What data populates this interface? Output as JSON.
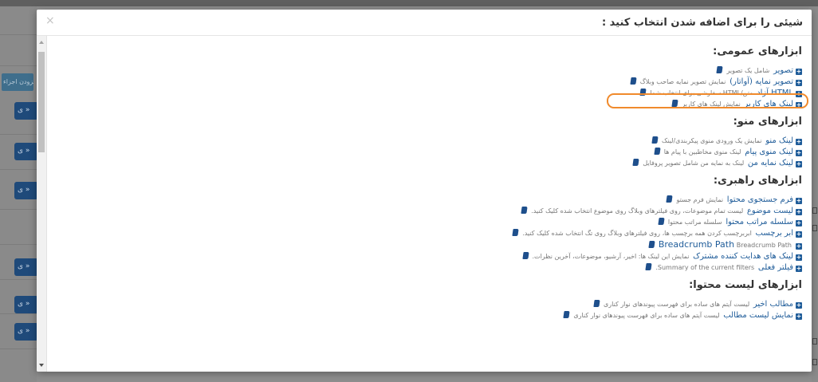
{
  "modal": {
    "title": "شیئی را برای اضافه شدن انتخاب کنید :",
    "close": "×",
    "sections": [
      {
        "title": "ابزارهای عمومی:",
        "items": [
          {
            "name": "تصویر",
            "desc": "شامل یک تصویر"
          },
          {
            "name": "تصویر نمایه (آواتار)",
            "desc": "نمایش تصویر نمایه صاحب وبلاگ"
          },
          {
            "name": "HTML آزاد",
            "desc": "متن/HTML سفارشی برای انتخاب شما"
          },
          {
            "name": "لینک های کاربر",
            "desc": "نمایش لینک های کاربر"
          }
        ]
      },
      {
        "title": "ابزارهای منو:",
        "items": [
          {
            "name": "لینک منو",
            "desc": "نمایش یک ورودی منوی پیکربندی/لینک"
          },
          {
            "name": "لینک منوی پیام",
            "desc": "لینک منوی مخاطبین با پیام ها"
          },
          {
            "name": "لینک نمایه من",
            "desc": "لینک به نمایه من شامل تصویر پروفایل"
          }
        ]
      },
      {
        "title": "ابزارهای راهبری:",
        "items": [
          {
            "name": "فرم جستجوی محتوا",
            "desc": "نمایش فرم جستو"
          },
          {
            "name": "لیست موضوع",
            "desc": "لیست تمام موضوعات، روی فیلترهای وبلاگ روی موضوع انتخاب شده کلیک کنید."
          },
          {
            "name": "سلسله مراتب محتوا",
            "desc": "سلسله مراتب محتوا"
          },
          {
            "name": "ابر برچسب",
            "desc": "ابربرچسب کردن همه برچسب ها، روی فیلترهای وبلاگ روی تگ انتخاب شده کلیک کنید."
          },
          {
            "name": "Breadcrumb Path",
            "desc": "Breadcrumb Path"
          },
          {
            "name": "لینک های هدایت کننده مشترک",
            "desc": "نمایش این لینک ها: اخیر، آرشیو، موضوعات، آخرین نظرات."
          },
          {
            "name": "فیلتر فعلی",
            "desc": "Summary of the current filters."
          }
        ]
      },
      {
        "title": "ابزارهای لیست محتوا:",
        "items": [
          {
            "name": "مطالب اخیر",
            "desc": "لیست آیتم های ساده برای فهرست پیوندهای نوار کناری"
          },
          {
            "name": "نمایش لیست مطالب",
            "desc": "لیست آیتم های ساده برای فهرست پیوندهای نوار کناری"
          }
        ]
      }
    ]
  },
  "background": {
    "add_parts": "افزودن اجزاء",
    "button_label": "ی »"
  },
  "colors": {
    "link": "#1f5c99",
    "highlight": "#f08a2c"
  }
}
